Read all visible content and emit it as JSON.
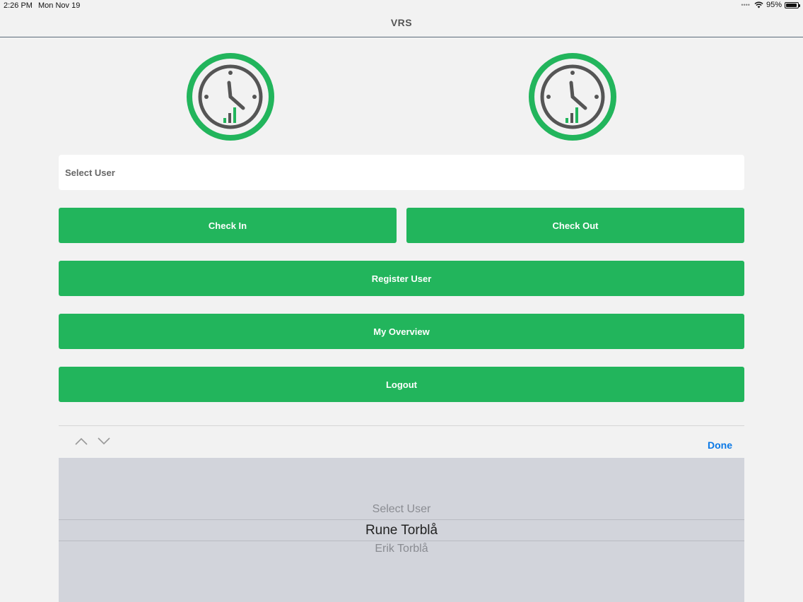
{
  "status_bar": {
    "time": "2:26 PM",
    "date": "Mon Nov 19",
    "battery": "95%",
    "battery_level": 0.95
  },
  "nav": {
    "title": "VRS"
  },
  "form": {
    "select_user_placeholder": "Select User"
  },
  "buttons": {
    "check_in": "Check In",
    "check_out": "Check Out",
    "register_user": "Register User",
    "my_overview": "My Overview",
    "logout": "Logout"
  },
  "picker": {
    "toolbar": {
      "done_label": "Done",
      "prev_icon": "chevron-up-icon",
      "next_icon": "chevron-down-icon"
    },
    "options": [
      "Select User",
      "Rune Torblå",
      "Erik Torblå"
    ],
    "selected": "Rune Torblå"
  },
  "colors": {
    "accent_green": "#22b55c",
    "link_blue": "#0a78e6",
    "picker_bg": "#d2d4db"
  }
}
